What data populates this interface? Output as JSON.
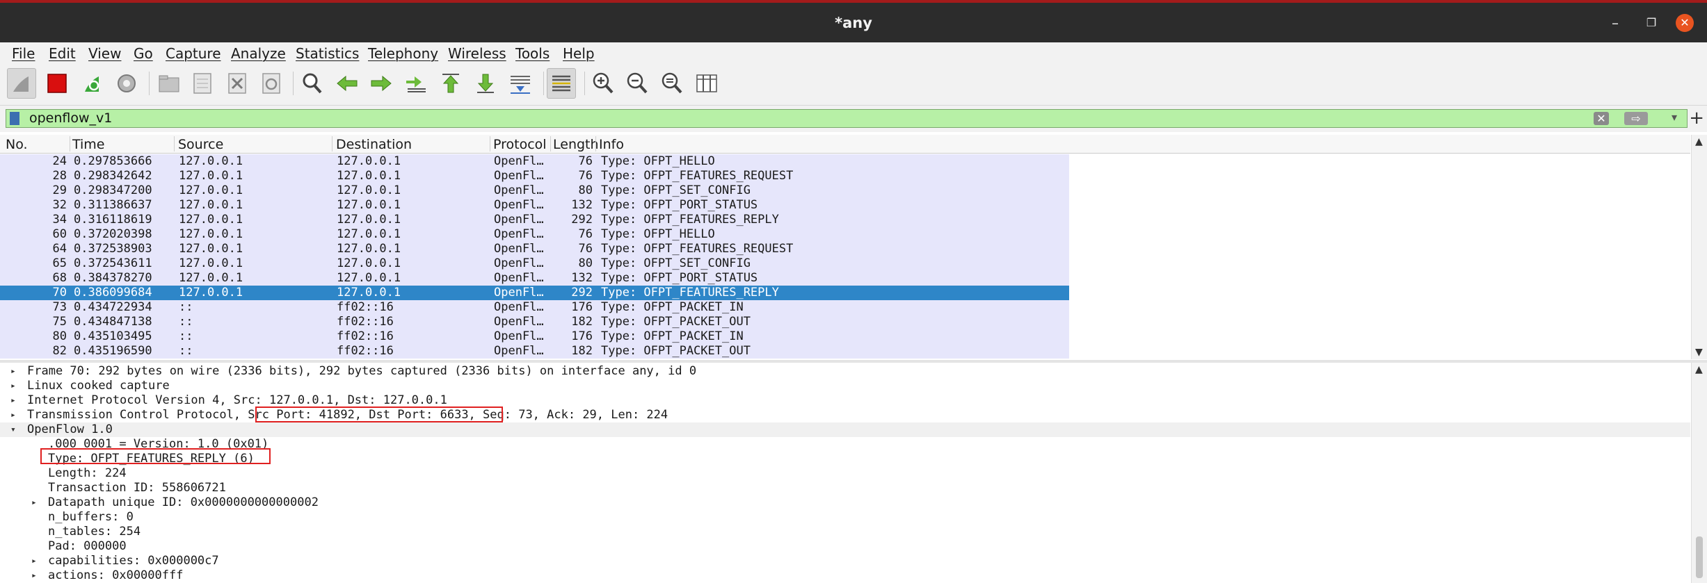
{
  "window": {
    "title": "*any"
  },
  "menu": [
    "File",
    "Edit",
    "View",
    "Go",
    "Capture",
    "Analyze",
    "Statistics",
    "Telephony",
    "Wireless",
    "Tools",
    "Help"
  ],
  "toolbar": {
    "icons": [
      "shark-fin-icon",
      "stop-capture-icon",
      "restart-capture-icon",
      "capture-options-icon",
      "open-file-icon",
      "save-file-icon",
      "close-file-icon",
      "reload-file-icon",
      "find-packet-icon",
      "go-back-icon",
      "go-forward-icon",
      "go-to-packet-icon",
      "first-packet-icon",
      "last-packet-icon",
      "auto-scroll-icon",
      "colorize-icon",
      "zoom-in-icon",
      "zoom-out-icon",
      "normal-size-icon",
      "resize-columns-icon"
    ]
  },
  "filter": {
    "value": "openflow_v1",
    "clear_glyph": "✕",
    "apply_glyph": "⇨",
    "dropdown_glyph": "▾",
    "add_glyph": "+"
  },
  "columns": [
    "No.",
    "Time",
    "Source",
    "Destination",
    "Protocol",
    "Length",
    "Info"
  ],
  "packets": [
    {
      "no": "24",
      "time": "0.297853666",
      "src": "127.0.0.1",
      "dst": "127.0.0.1",
      "proto": "OpenFl…",
      "len": "76",
      "info": "Type: OFPT_HELLO"
    },
    {
      "no": "28",
      "time": "0.298342642",
      "src": "127.0.0.1",
      "dst": "127.0.0.1",
      "proto": "OpenFl…",
      "len": "76",
      "info": "Type: OFPT_FEATURES_REQUEST"
    },
    {
      "no": "29",
      "time": "0.298347200",
      "src": "127.0.0.1",
      "dst": "127.0.0.1",
      "proto": "OpenFl…",
      "len": "80",
      "info": "Type: OFPT_SET_CONFIG"
    },
    {
      "no": "32",
      "time": "0.311386637",
      "src": "127.0.0.1",
      "dst": "127.0.0.1",
      "proto": "OpenFl…",
      "len": "132",
      "info": "Type: OFPT_PORT_STATUS"
    },
    {
      "no": "34",
      "time": "0.316118619",
      "src": "127.0.0.1",
      "dst": "127.0.0.1",
      "proto": "OpenFl…",
      "len": "292",
      "info": "Type: OFPT_FEATURES_REPLY"
    },
    {
      "no": "60",
      "time": "0.372020398",
      "src": "127.0.0.1",
      "dst": "127.0.0.1",
      "proto": "OpenFl…",
      "len": "76",
      "info": "Type: OFPT_HELLO"
    },
    {
      "no": "64",
      "time": "0.372538903",
      "src": "127.0.0.1",
      "dst": "127.0.0.1",
      "proto": "OpenFl…",
      "len": "76",
      "info": "Type: OFPT_FEATURES_REQUEST"
    },
    {
      "no": "65",
      "time": "0.372543611",
      "src": "127.0.0.1",
      "dst": "127.0.0.1",
      "proto": "OpenFl…",
      "len": "80",
      "info": "Type: OFPT_SET_CONFIG"
    },
    {
      "no": "68",
      "time": "0.384378270",
      "src": "127.0.0.1",
      "dst": "127.0.0.1",
      "proto": "OpenFl…",
      "len": "132",
      "info": "Type: OFPT_PORT_STATUS"
    },
    {
      "no": "70",
      "time": "0.386099684",
      "src": "127.0.0.1",
      "dst": "127.0.0.1",
      "proto": "OpenFl…",
      "len": "292",
      "info": "Type: OFPT_FEATURES_REPLY",
      "selected": true
    },
    {
      "no": "73",
      "time": "0.434722934",
      "src": "::",
      "dst": "ff02::16",
      "proto": "OpenFl…",
      "len": "176",
      "info": "Type: OFPT_PACKET_IN"
    },
    {
      "no": "75",
      "time": "0.434847138",
      "src": "::",
      "dst": "ff02::16",
      "proto": "OpenFl…",
      "len": "182",
      "info": "Type: OFPT_PACKET_OUT"
    },
    {
      "no": "80",
      "time": "0.435103495",
      "src": "::",
      "dst": "ff02::16",
      "proto": "OpenFl…",
      "len": "176",
      "info": "Type: OFPT_PACKET_IN"
    },
    {
      "no": "82",
      "time": "0.435196590",
      "src": "::",
      "dst": "ff02::16",
      "proto": "OpenFl…",
      "len": "182",
      "info": "Type: OFPT_PACKET_OUT"
    }
  ],
  "details": [
    {
      "text": "Frame 70: 292 bytes on wire (2336 bits), 292 bytes captured (2336 bits) on interface any, id 0",
      "level": 0,
      "arrow": "▸"
    },
    {
      "text": "Linux cooked capture",
      "level": 0,
      "arrow": "▸"
    },
    {
      "text": "Internet Protocol Version 4, Src: 127.0.0.1, Dst: 127.0.0.1",
      "level": 0,
      "arrow": "▸"
    },
    {
      "text": "Transmission Control Protocol, Src Port: 41892, Dst Port: 6633, Seq: 73, Ack: 29, Len: 224",
      "level": 0,
      "arrow": "▸"
    },
    {
      "text": "OpenFlow 1.0",
      "level": 0,
      "arrow": "▾",
      "highlight": true
    },
    {
      "text": ".000 0001 = Version: 1.0 (0x01)",
      "level": 1,
      "arrow": ""
    },
    {
      "text": "Type: OFPT_FEATURES_REPLY (6)",
      "level": 1,
      "arrow": ""
    },
    {
      "text": "Length: 224",
      "level": 1,
      "arrow": ""
    },
    {
      "text": "Transaction ID: 558606721",
      "level": 1,
      "arrow": ""
    },
    {
      "text": "Datapath unique ID: 0x0000000000000002",
      "level": 1,
      "arrow": "▸"
    },
    {
      "text": "n_buffers: 0",
      "level": 1,
      "arrow": ""
    },
    {
      "text": "n_tables: 254",
      "level": 1,
      "arrow": ""
    },
    {
      "text": "Pad: 000000",
      "level": 1,
      "arrow": ""
    },
    {
      "text": "capabilities: 0x000000c7",
      "level": 1,
      "arrow": "▸"
    },
    {
      "text": "actions: 0x00000fff",
      "level": 1,
      "arrow": "▸"
    }
  ],
  "window_controls": {
    "minimize": "–",
    "maximize": "❐",
    "close": "✕"
  },
  "colors": {
    "filter_valid": "#b7f0a6",
    "row_bg": "#e6e6fb",
    "selected_row": "#2e86c8",
    "annotation_box": "#e02020",
    "titlebar": "#2c2c2c",
    "close_button": "#e95420"
  }
}
